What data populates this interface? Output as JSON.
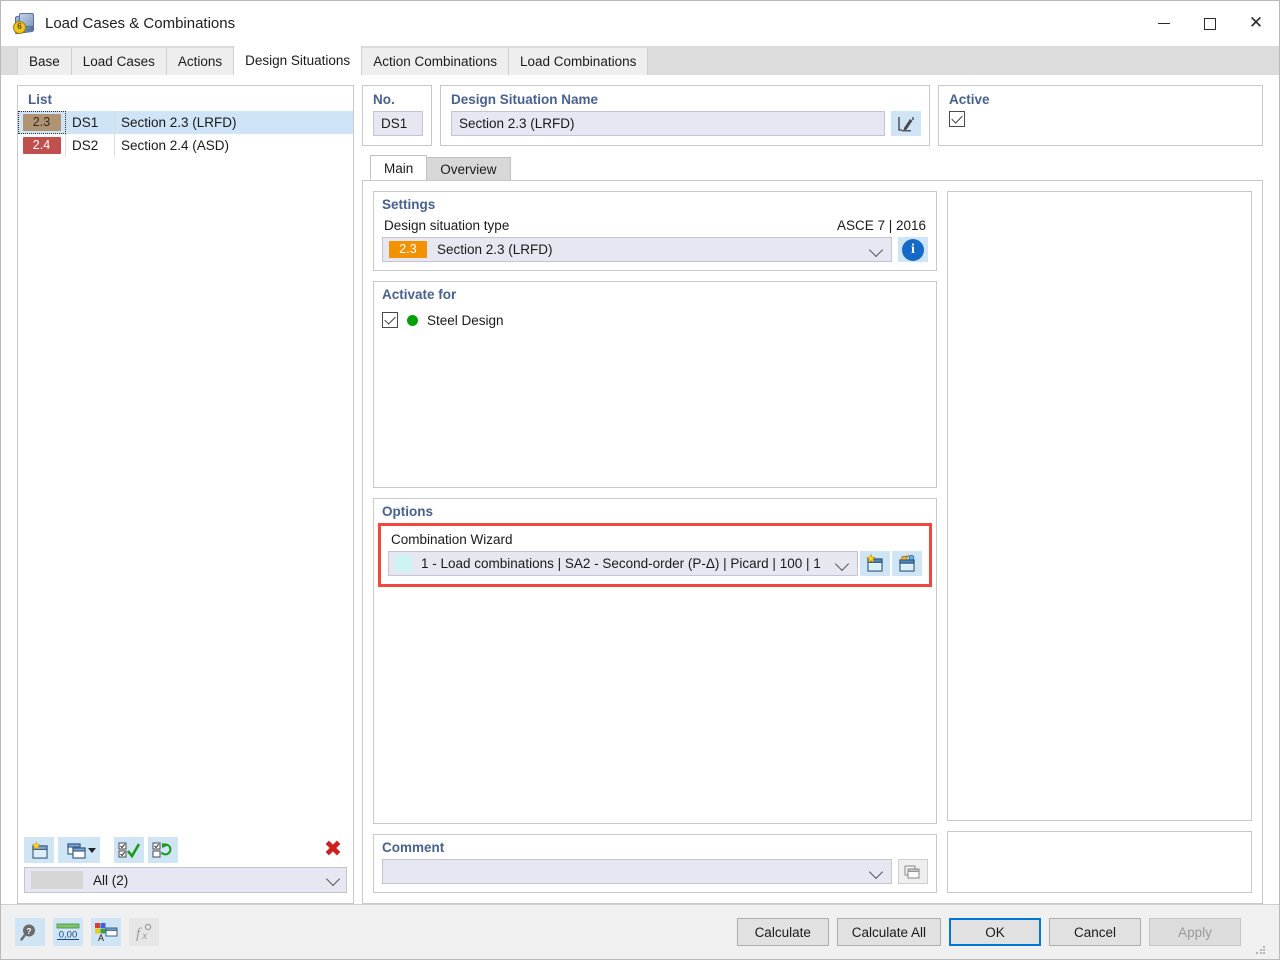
{
  "window": {
    "title": "Load Cases & Combinations",
    "app_icon": "load-cases-icon",
    "minimize": "minimize-icon",
    "maximize": "maximize-icon",
    "close": "close-icon"
  },
  "tabs": [
    {
      "label": "Base",
      "active": false
    },
    {
      "label": "Load Cases",
      "active": false
    },
    {
      "label": "Actions",
      "active": false
    },
    {
      "label": "Design Situations",
      "active": true
    },
    {
      "label": "Action Combinations",
      "active": false
    },
    {
      "label": "Load Combinations",
      "active": false
    }
  ],
  "list": {
    "title": "List",
    "rows": [
      {
        "badge": "2.3",
        "badge_color": "#b09471",
        "no": "DS1",
        "name": "Section 2.3 (LRFD)",
        "selected": true
      },
      {
        "badge": "2.4",
        "badge_color": "#c0504d",
        "no": "DS2",
        "name": "Section 2.4 (ASD)",
        "selected": false
      }
    ],
    "toolbar": [
      {
        "name": "new-design-situation-button",
        "icon": "new-window-icon"
      },
      {
        "name": "copy-design-situation-button",
        "icon": "copy-window-dropdown-icon"
      },
      {
        "name": "select-all-button",
        "icon": "check-all-icon"
      },
      {
        "name": "invert-selection-button",
        "icon": "invert-selection-icon"
      },
      {
        "name": "delete-button",
        "icon": "red-x-icon"
      }
    ],
    "filter": {
      "label": "All (2)",
      "swatch": "#d6d6d6"
    }
  },
  "details": {
    "no": {
      "title": "No.",
      "value": "DS1"
    },
    "name": {
      "title": "Design Situation Name",
      "value": "Section 2.3 (LRFD)",
      "edit_icon": "edit-pencil-icon"
    },
    "active": {
      "title": "Active",
      "checked": true
    }
  },
  "inner_tabs": [
    {
      "label": "Main",
      "active": true
    },
    {
      "label": "Overview",
      "active": false
    }
  ],
  "settings": {
    "title": "Settings",
    "type_label": "Design situation type",
    "standard": "ASCE 7 | 2016",
    "type_badge": "2.3",
    "type_badge_color": "#f39200",
    "type_value": "Section 2.3 (LRFD)",
    "info_icon": "info-icon"
  },
  "activate_for": {
    "title": "Activate for",
    "items": [
      {
        "label": "Steel Design",
        "checked": true,
        "dot_color": "#00a000"
      }
    ]
  },
  "options": {
    "title": "Options",
    "wizard_label": "Combination Wizard",
    "wizard_swatch": "#cdf3f3",
    "wizard_value": "1 - Load combinations | SA2 - Second-order (P-Δ) | Picard | 100 | 1",
    "new_wizard_icon": "new-wizard-icon",
    "edit_wizard_icon": "edit-wizard-icon",
    "highlight_color": "#f0483e"
  },
  "comment": {
    "title": "Comment",
    "value": "",
    "placeholder": "",
    "copy_icon": "copy-comment-icon"
  },
  "footer": {
    "icons": [
      {
        "name": "help-button",
        "icon": "help-magnifier-icon",
        "disabled": false
      },
      {
        "name": "decimal-places-button",
        "icon": "decimal-places-icon",
        "disabled": false
      },
      {
        "name": "display-properties-button",
        "icon": "display-properties-icon",
        "disabled": false
      },
      {
        "name": "formula-button",
        "icon": "formula-fx-icon",
        "disabled": true
      }
    ],
    "buttons": [
      {
        "label": "Calculate",
        "style": "normal"
      },
      {
        "label": "Calculate All",
        "style": "normal"
      },
      {
        "label": "OK",
        "style": "primary"
      },
      {
        "label": "Cancel",
        "style": "normal"
      },
      {
        "label": "Apply",
        "style": "disabled"
      }
    ]
  }
}
